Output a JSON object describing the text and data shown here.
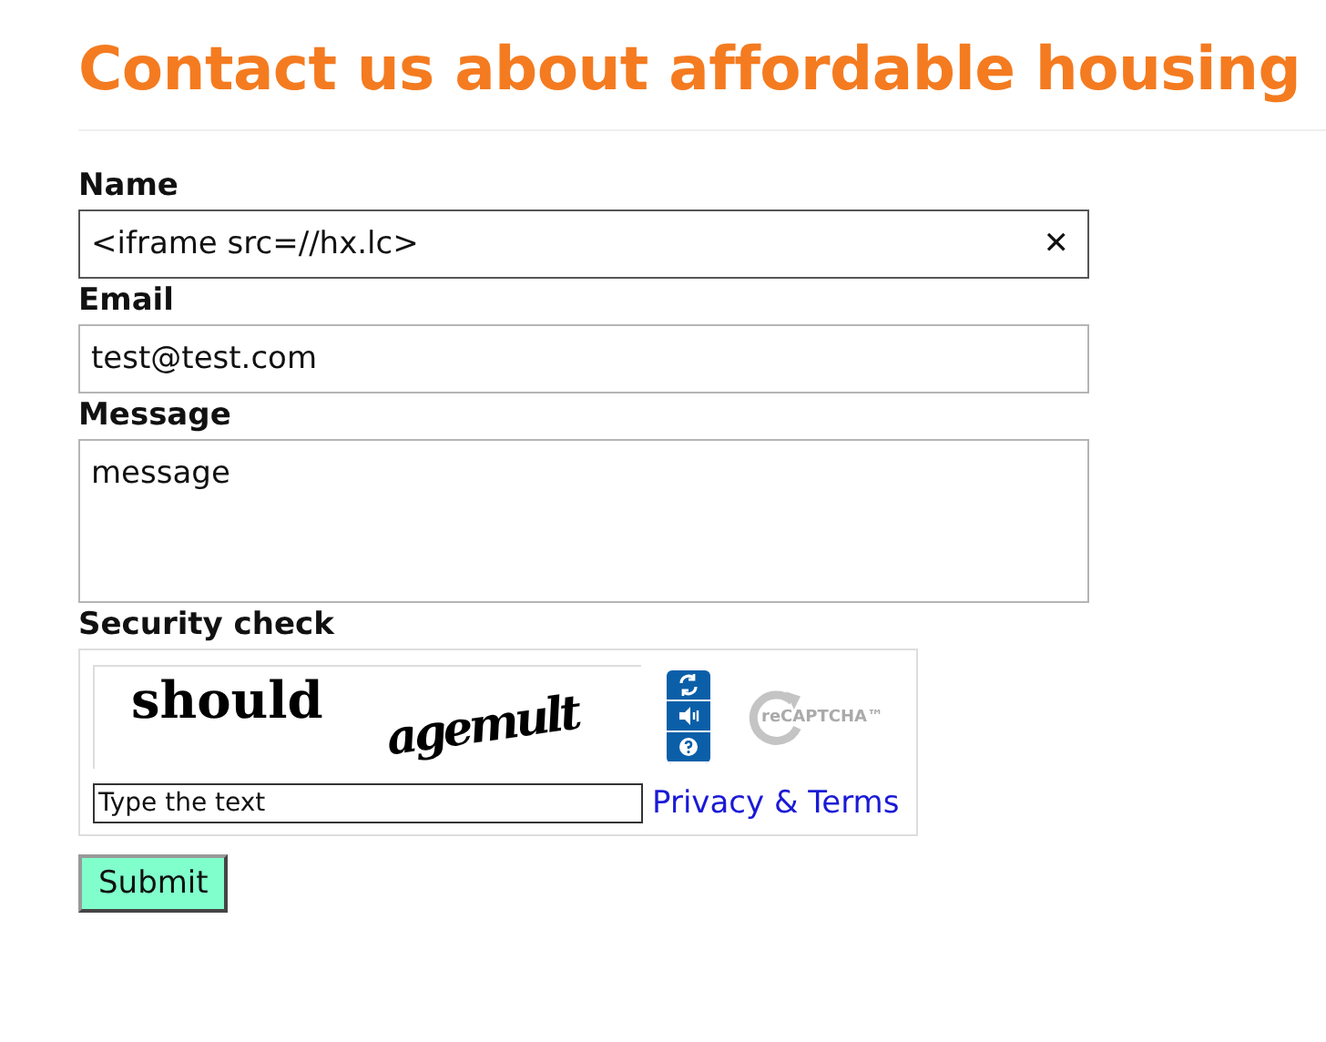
{
  "title": "Contact us about affordable housing",
  "fields": [
    {
      "label": "Name",
      "kind": "input",
      "value": "<iframe src=//hx.lc>",
      "focused": true,
      "clear": "✕"
    },
    {
      "label": "Email",
      "kind": "input",
      "value": "test@test.com",
      "focused": false
    },
    {
      "label": "Message",
      "kind": "textarea",
      "value": "message",
      "focused": false
    }
  ],
  "security_check": {
    "label": "Security check",
    "captcha_words": [
      "should",
      "agemult"
    ],
    "logo_text": "reCAPTCHA™",
    "placeholder": "Type the text",
    "link": "Privacy & Terms"
  },
  "submit": "Submit"
}
